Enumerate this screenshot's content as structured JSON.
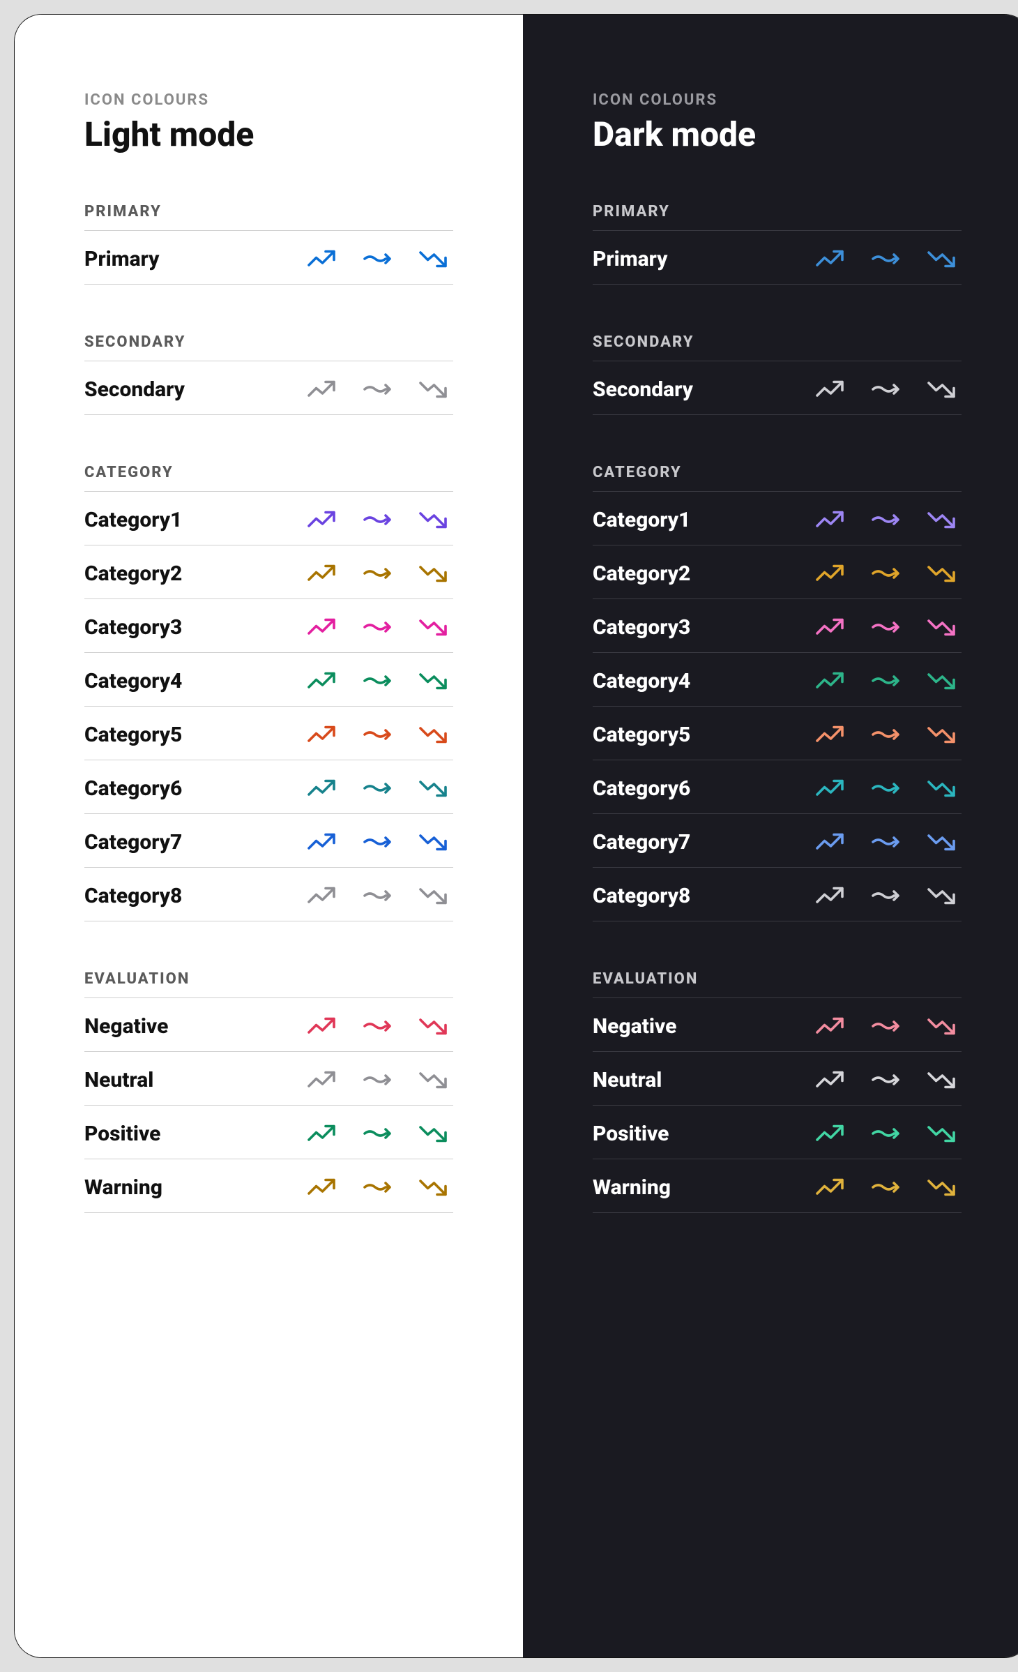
{
  "eyebrow": "ICON COLOURS",
  "modes": {
    "light": {
      "title": "Light mode"
    },
    "dark": {
      "title": "Dark mode"
    }
  },
  "iconSet": [
    "trend-up",
    "trend-flat",
    "trend-down"
  ],
  "sections": [
    {
      "label": "PRIMARY",
      "rows": [
        {
          "label": "Primary",
          "light": "#0a6fd6",
          "dark": "#3d8fd9"
        }
      ]
    },
    {
      "label": "SECONDARY",
      "rows": [
        {
          "label": "Secondary",
          "light": "#8f8f94",
          "dark": "#cfcfd4"
        }
      ]
    },
    {
      "label": "CATEGORY",
      "rows": [
        {
          "label": "Category1",
          "light": "#6a43e0",
          "dark": "#9d86f4"
        },
        {
          "label": "Category2",
          "light": "#a87400",
          "dark": "#e0a52a"
        },
        {
          "label": "Category3",
          "light": "#e31fa0",
          "dark": "#f472c4"
        },
        {
          "label": "Category4",
          "light": "#0b8d5d",
          "dark": "#2db58a"
        },
        {
          "label": "Category5",
          "light": "#d84a1b",
          "dark": "#f4916a"
        },
        {
          "label": "Category6",
          "light": "#16828c",
          "dark": "#2bb6bf"
        },
        {
          "label": "Category7",
          "light": "#1760d6",
          "dark": "#6b9cf0"
        },
        {
          "label": "Category8",
          "light": "#8f8f94",
          "dark": "#cfcfd4"
        }
      ]
    },
    {
      "label": "EVALUATION",
      "rows": [
        {
          "label": "Negative",
          "light": "#e03757",
          "dark": "#f38da0"
        },
        {
          "label": "Neutral",
          "light": "#8f8f94",
          "dark": "#d6d6da"
        },
        {
          "label": "Positive",
          "light": "#0b8d5d",
          "dark": "#42d6a4"
        },
        {
          "label": "Warning",
          "light": "#a87400",
          "dark": "#e0b23c"
        }
      ]
    }
  ]
}
